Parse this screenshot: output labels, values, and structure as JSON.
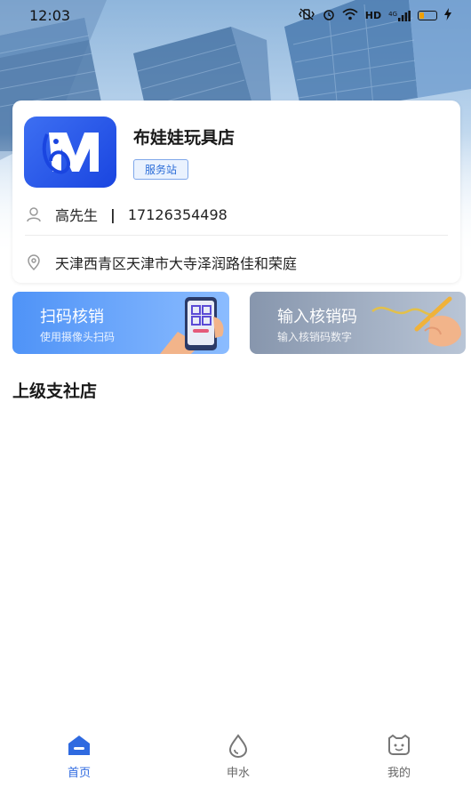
{
  "status_bar": {
    "time": "12:03",
    "network": "4G",
    "hd": "HD"
  },
  "store": {
    "name": "布娃娃玩具店",
    "badge": "服务站",
    "contact_name": "高先生",
    "separator": "|",
    "phone": "17126354498",
    "address": "天津西青区天津市大寺泽润路佳和荣庭"
  },
  "actions": [
    {
      "title": "扫码核销",
      "subtitle": "使用摄像头扫码"
    },
    {
      "title": "输入核销码",
      "subtitle": "输入核销码数字"
    }
  ],
  "section": {
    "title": "上级支社店"
  },
  "tabbar": {
    "items": [
      {
        "label": "首页",
        "icon": "home-icon",
        "active": true
      },
      {
        "label": "申水",
        "icon": "water-drop-icon",
        "active": false
      },
      {
        "label": "我的",
        "icon": "smiley-face-icon",
        "active": false
      }
    ]
  },
  "colors": {
    "accent": "#2f6ae0",
    "scan_tile": "#4f93f7",
    "input_tile": "#8796ad"
  }
}
